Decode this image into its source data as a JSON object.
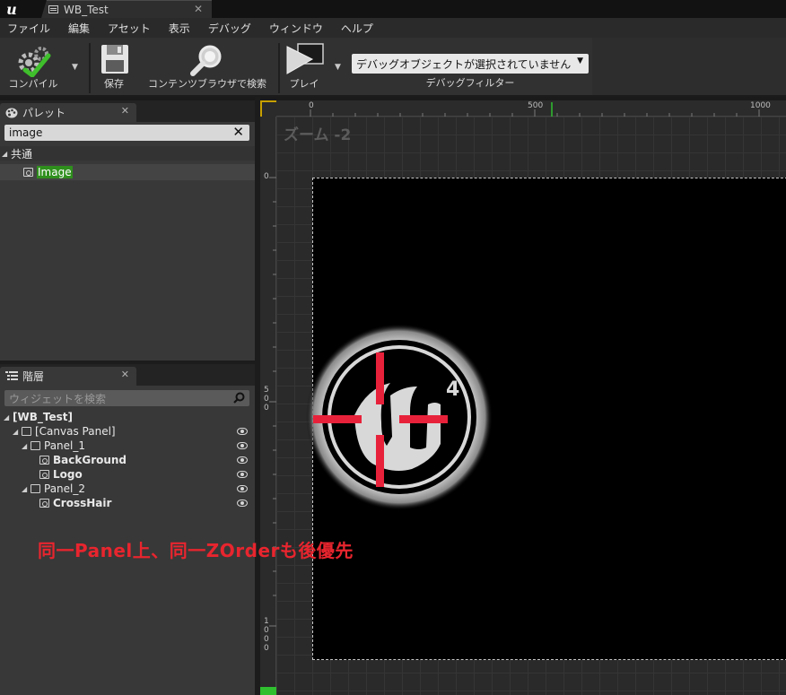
{
  "window": {
    "tab_title": "WB_Test",
    "tab_close": "✕",
    "logo": "u"
  },
  "menu": [
    "ファイル",
    "編集",
    "アセット",
    "表示",
    "デバッグ",
    "ウィンドウ",
    "ヘルプ"
  ],
  "toolbar": {
    "compile_label": "コンパイル",
    "save_label": "保存",
    "browse_label": "コンテンツブラウザで検索",
    "play_label": "プレイ",
    "debug_object_value": "デバッグオブジェクトが選択されていません",
    "debug_filter_label": "デバッグフィルター",
    "icons": {
      "compile": "compile-check-gear-icon",
      "save": "floppy-disk-icon",
      "browse": "magnifier-icon",
      "play": "play-icon"
    }
  },
  "palette": {
    "tab_label": "パレット",
    "tab_close": "✕",
    "search_value": "image",
    "search_clear": "✕",
    "category": "共通",
    "items": [
      {
        "label": "Image",
        "highlight": true
      }
    ]
  },
  "hierarchy": {
    "tab_label": "階層",
    "tab_close": "✕",
    "search_placeholder": "ウィジェットを検索",
    "nodes": [
      {
        "label": "[WB_Test]",
        "depth": 0,
        "bold": true,
        "expanded": true,
        "icon": "none",
        "visible_toggle": false
      },
      {
        "label": "[Canvas Panel]",
        "depth": 1,
        "bold": false,
        "expanded": true,
        "icon": "panel",
        "visible_toggle": true
      },
      {
        "label": "Panel_1",
        "depth": 2,
        "bold": false,
        "expanded": true,
        "icon": "panel",
        "visible_toggle": true
      },
      {
        "label": "BackGround",
        "depth": 3,
        "bold": true,
        "expanded": false,
        "icon": "image",
        "visible_toggle": true
      },
      {
        "label": "Logo",
        "depth": 3,
        "bold": true,
        "expanded": false,
        "icon": "image",
        "visible_toggle": true
      },
      {
        "label": "Panel_2",
        "depth": 2,
        "bold": false,
        "expanded": true,
        "icon": "panel",
        "visible_toggle": true
      },
      {
        "label": "CrossHair",
        "depth": 3,
        "bold": true,
        "expanded": false,
        "icon": "image",
        "visible_toggle": true
      }
    ]
  },
  "designer": {
    "zoom_label": "ズーム -2",
    "ruler_h": [
      "0",
      "500",
      "1000"
    ],
    "ruler_v": [
      "0",
      "5\n0\n0",
      "1\n0\n0\n0"
    ],
    "canvas_bg": "#000000",
    "crosshair_color": "#e8213a",
    "logo_text": "4"
  },
  "annotation": {
    "text": "同一Panel上、同一ZOrderも後優先",
    "color": "#e8252e"
  }
}
